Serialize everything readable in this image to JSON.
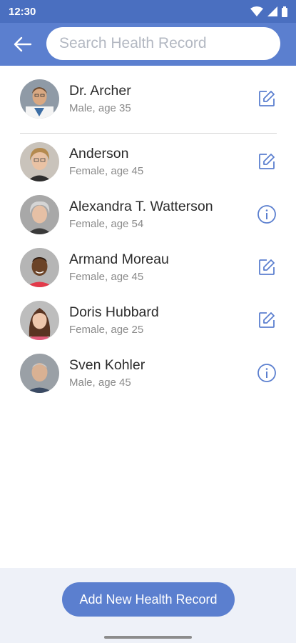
{
  "status_bar": {
    "time": "12:30",
    "icons": [
      "wifi-icon",
      "cell-signal-icon",
      "battery-icon"
    ]
  },
  "app_bar": {
    "back_icon": "arrow-left-icon",
    "search": {
      "placeholder": "Search Health Record",
      "value": ""
    }
  },
  "records": [
    {
      "name": "Dr. Archer",
      "details": "Male, age 35",
      "action": "edit-icon"
    },
    {
      "name": "Anderson",
      "details": "Female, age 45",
      "action": "edit-icon"
    },
    {
      "name": "Alexandra T. Watterson",
      "details": "Female, age 54",
      "action": "info-icon"
    },
    {
      "name": "Armand Moreau",
      "details": "Female, age 45",
      "action": "edit-icon"
    },
    {
      "name": "Doris Hubbard",
      "details": "Female, age 25",
      "action": "edit-icon"
    },
    {
      "name": "Sven Kohler",
      "details": "Male, age 45",
      "action": "info-icon"
    }
  ],
  "footer": {
    "add_button_label": "Add New Health Record"
  },
  "colors": {
    "primary": "#5b7fcf",
    "status_bar": "#4a6fc0",
    "footer_bg": "#eef1f8"
  }
}
